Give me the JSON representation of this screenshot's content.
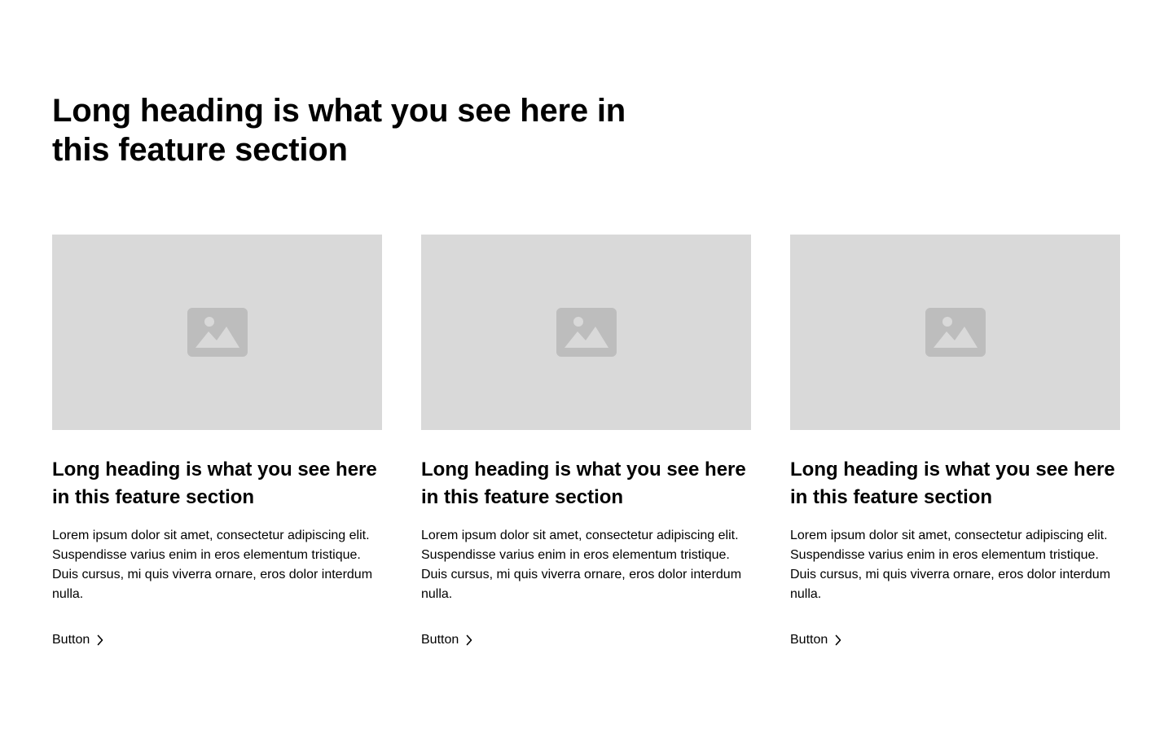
{
  "section": {
    "heading": "Long heading is what you see here in this feature section"
  },
  "cards": [
    {
      "image_icon": "image-placeholder-icon",
      "heading": "Long heading is what you see here in this feature section",
      "text": "Lorem ipsum dolor sit amet, consectetur adipiscing elit. Suspendisse varius enim in eros elementum tristique. Duis cursus, mi quis viverra ornare, eros dolor interdum nulla.",
      "button_label": "Button",
      "button_icon": "chevron-right-icon"
    },
    {
      "image_icon": "image-placeholder-icon",
      "heading": "Long heading is what you see here in this feature section",
      "text": "Lorem ipsum dolor sit amet, consectetur adipiscing elit. Suspendisse varius enim in eros elementum tristique. Duis cursus, mi quis viverra ornare, eros dolor interdum nulla.",
      "button_label": "Button",
      "button_icon": "chevron-right-icon"
    },
    {
      "image_icon": "image-placeholder-icon",
      "heading": "Long heading is what you see here in this feature section",
      "text": "Lorem ipsum dolor sit amet, consectetur adipiscing elit. Suspendisse varius enim in eros elementum tristique. Duis cursus, mi quis viverra ornare, eros dolor interdum nulla.",
      "button_label": "Button",
      "button_icon": "chevron-right-icon"
    }
  ],
  "colors": {
    "background": "#ffffff",
    "text": "#000000",
    "placeholder_bg": "#d9d9d9",
    "placeholder_icon": "#bdbdbd"
  }
}
